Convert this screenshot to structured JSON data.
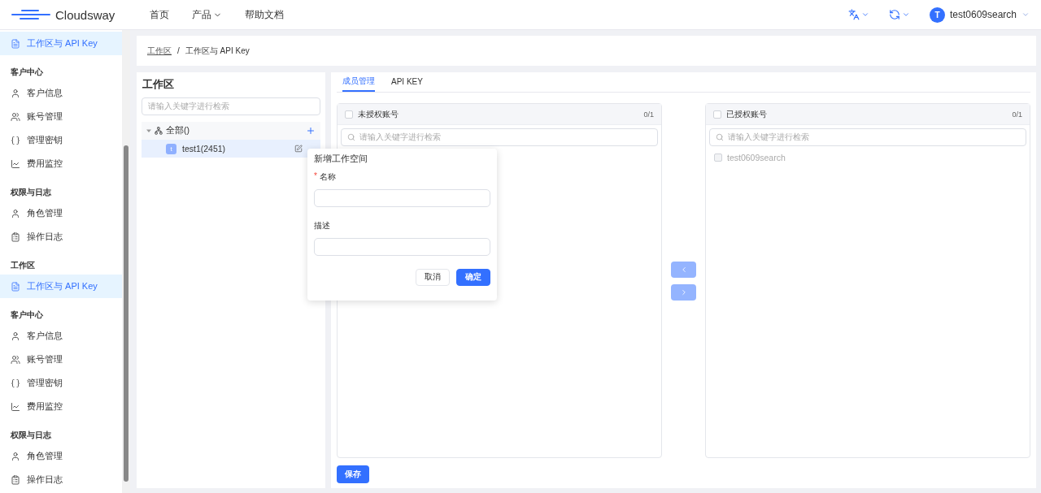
{
  "header": {
    "brand": "Cloudsway",
    "nav": [
      {
        "label": "首页",
        "dropdown": false
      },
      {
        "label": "产品",
        "dropdown": true
      },
      {
        "label": "帮助文档",
        "dropdown": false
      }
    ],
    "user": {
      "avatar": "T",
      "name": "test0609search"
    }
  },
  "sidebar": {
    "sections": [
      {
        "items": [
          {
            "label": "工作区与 API Key",
            "selected": true
          }
        ]
      },
      {
        "title": "客户中心",
        "items": [
          {
            "label": "客户信息",
            "selected": false
          },
          {
            "label": "账号管理",
            "selected": false
          },
          {
            "label": "管理密钥",
            "selected": false
          },
          {
            "label": "费用监控",
            "selected": false
          }
        ]
      },
      {
        "title": "权限与日志",
        "items": [
          {
            "label": "角色管理",
            "selected": false
          },
          {
            "label": "操作日志",
            "selected": false
          }
        ]
      },
      {
        "title": "工作区",
        "items": [
          {
            "label": "工作区与 API Key",
            "selected": true
          }
        ]
      },
      {
        "title": "客户中心",
        "items": [
          {
            "label": "客户信息",
            "selected": false
          },
          {
            "label": "账号管理",
            "selected": false
          },
          {
            "label": "管理密钥",
            "selected": false
          },
          {
            "label": "费用监控",
            "selected": false
          }
        ]
      },
      {
        "title": "权限与日志",
        "items": [
          {
            "label": "角色管理",
            "selected": false
          },
          {
            "label": "操作日志",
            "selected": false
          }
        ]
      }
    ]
  },
  "breadcrumb": [
    {
      "label": "工作区",
      "link": true
    },
    {
      "label": "/",
      "link": false
    },
    {
      "label": "工作区与 API Key",
      "link": false
    }
  ],
  "workspace": {
    "title": "工作区",
    "search": {
      "placeholder": "请输入关键字进行检索"
    },
    "tree": {
      "label": "全部()",
      "expanded": true,
      "children": [
        {
          "avatar": "t",
          "label": "test1(2451)",
          "selected": true
        }
      ]
    }
  },
  "tabs": [
    {
      "label": "成员管理",
      "selected": true
    },
    {
      "label": "API KEY",
      "selected": false
    }
  ],
  "transfer": {
    "lists": [
      {
        "title": "未授权账号",
        "count": "0/1",
        "checked": false,
        "search": {
          "placeholder": "请输入关键字进行检索"
        }
      },
      {
        "title": "已授权账号",
        "count": "0/1",
        "checked": false,
        "search": {
          "placeholder": "请输入关键字进行检索"
        },
        "items": [
          {
            "label": "test0609search",
            "checked": false,
            "disabled": true
          }
        ]
      }
    ],
    "buttons": [
      {
        "disabled": true
      },
      {
        "disabled": true
      }
    ]
  },
  "save_button": "保存",
  "popover": {
    "title": "新增工作空间",
    "fields": [
      {
        "label": "名称",
        "required_mark": "*"
      },
      {
        "label": "描述"
      }
    ],
    "buttons": [
      {
        "label": "取消",
        "primary": false
      },
      {
        "label": "确定",
        "primary": true
      }
    ]
  }
}
